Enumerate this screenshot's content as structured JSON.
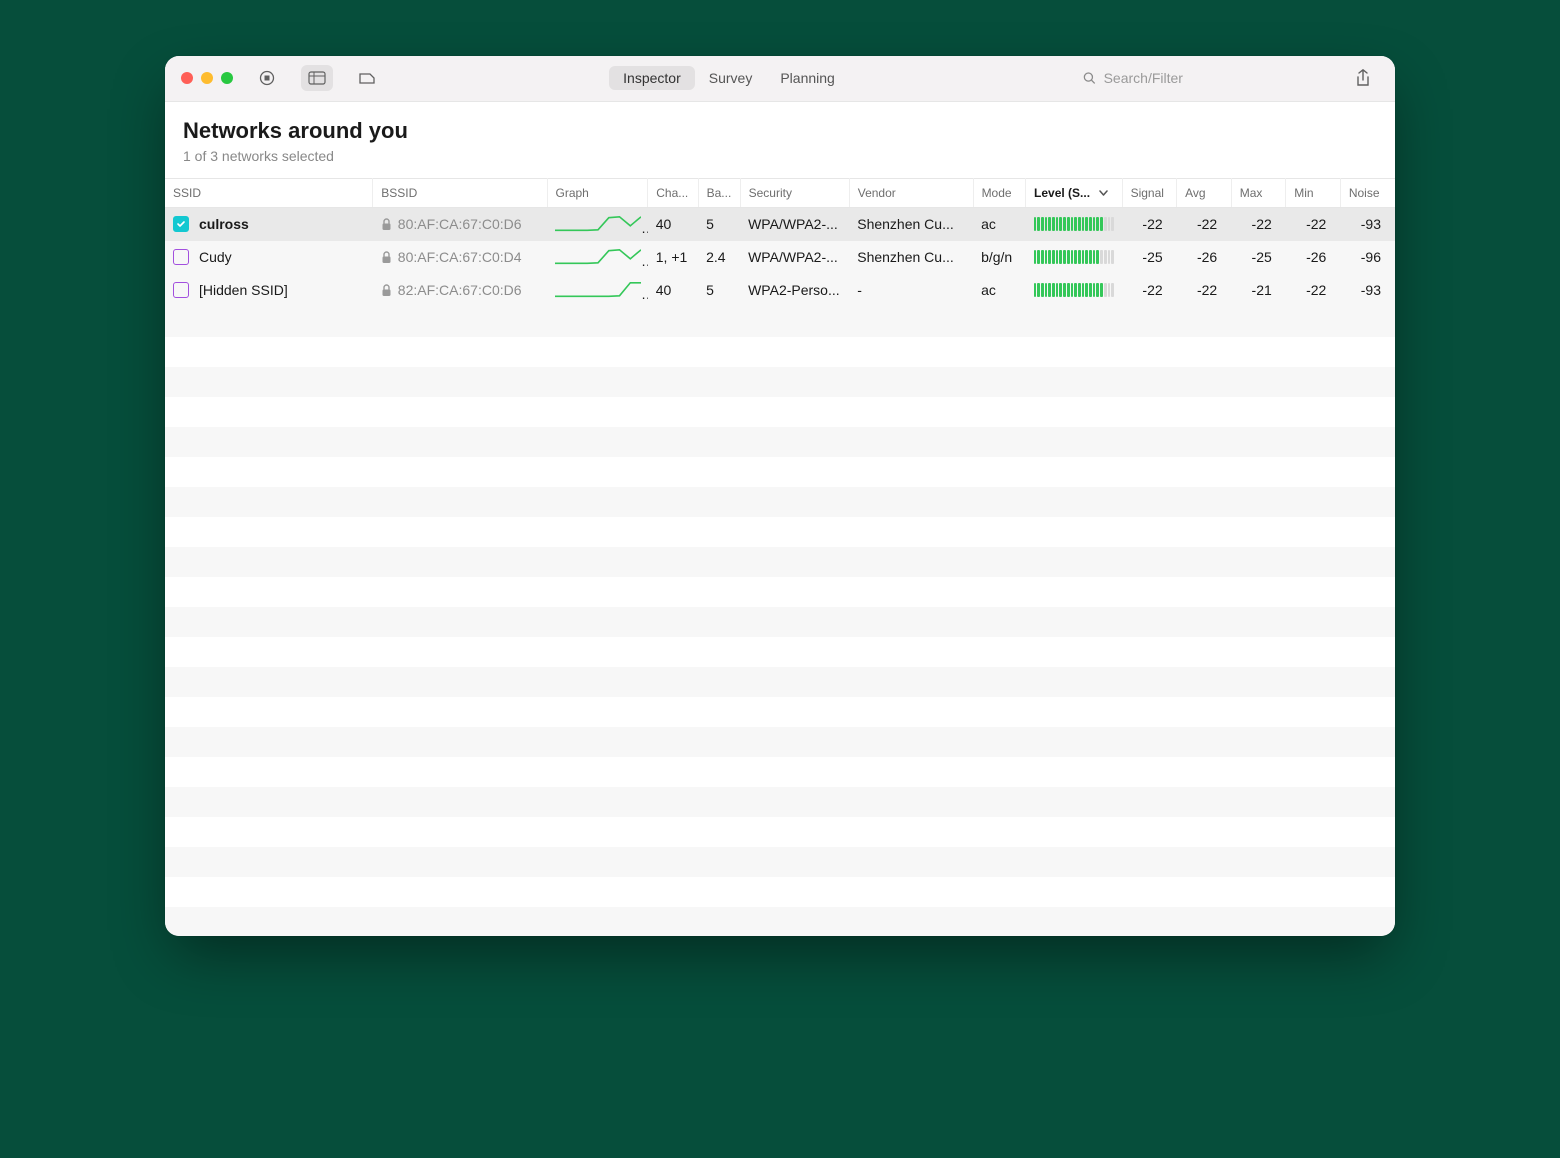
{
  "toolbar": {
    "tabs": [
      "Inspector",
      "Survey",
      "Planning"
    ],
    "active_tab": 0,
    "search_placeholder": "Search/Filter"
  },
  "page": {
    "title": "Networks around you",
    "subtitle": "1 of 3 networks selected"
  },
  "columns": [
    {
      "key": "ssid",
      "label": "SSID"
    },
    {
      "key": "bssid",
      "label": "BSSID"
    },
    {
      "key": "graph",
      "label": "Graph"
    },
    {
      "key": "channel",
      "label": "Cha..."
    },
    {
      "key": "band",
      "label": "Ba..."
    },
    {
      "key": "security",
      "label": "Security"
    },
    {
      "key": "vendor",
      "label": "Vendor"
    },
    {
      "key": "mode",
      "label": "Mode"
    },
    {
      "key": "level",
      "label": "Level (S...",
      "sorted": true,
      "dir": "desc"
    },
    {
      "key": "signal",
      "label": "Signal"
    },
    {
      "key": "avg",
      "label": "Avg"
    },
    {
      "key": "max",
      "label": "Max"
    },
    {
      "key": "min",
      "label": "Min"
    },
    {
      "key": "noise",
      "label": "Noise"
    }
  ],
  "rows": [
    {
      "checked": true,
      "ssid": "culross",
      "bssid": "80:AF:CA:67:C0:D6",
      "locked": true,
      "graph": [
        0.15,
        0.15,
        0.15,
        0.15,
        0.18,
        0.85,
        0.9,
        0.4,
        0.9
      ],
      "channel": "40",
      "band": "5",
      "security": "WPA/WPA2-...",
      "vendor": "Shenzhen Cu...",
      "mode": "ac",
      "level_pct": 88,
      "signal": -22,
      "avg": -22,
      "max": -22,
      "min": -22,
      "noise": -93
    },
    {
      "checked": false,
      "ssid": "Cudy",
      "bssid": "80:AF:CA:67:C0:D4",
      "locked": true,
      "graph": [
        0.15,
        0.15,
        0.15,
        0.15,
        0.18,
        0.85,
        0.9,
        0.4,
        0.9
      ],
      "channel": "1, +1",
      "band": "2.4",
      "security": "WPA/WPA2-...",
      "vendor": "Shenzhen Cu...",
      "mode": "b/g/n",
      "level_pct": 80,
      "signal": -25,
      "avg": -26,
      "max": -25,
      "min": -26,
      "noise": -96
    },
    {
      "checked": false,
      "ssid": "[Hidden SSID]",
      "bssid": "82:AF:CA:67:C0:D6",
      "locked": true,
      "graph": [
        0.15,
        0.15,
        0.15,
        0.15,
        0.15,
        0.15,
        0.18,
        0.9,
        0.9
      ],
      "channel": "40",
      "band": "5",
      "security": "WPA2-Perso...",
      "vendor": "-",
      "mode": "ac",
      "level_pct": 88,
      "signal": -22,
      "avg": -22,
      "max": -21,
      "min": -22,
      "noise": -93
    }
  ]
}
